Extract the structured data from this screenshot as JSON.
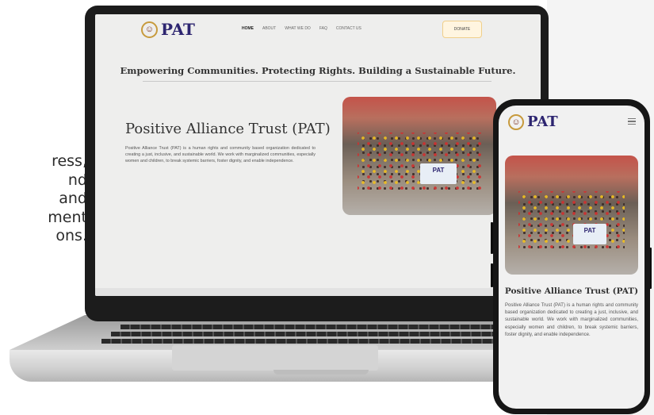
{
  "side_text_lines": [
    "ress,",
    "nd",
    "and",
    "ment",
    "ons."
  ],
  "laptop_site": {
    "logo": "PAT",
    "menu": [
      "HOME",
      "ABOUT",
      "WHAT WE DO",
      "FAQ",
      "CONTACT US"
    ],
    "donate_label": "DONATE",
    "tagline": "Empowering Communities. Protecting Rights. Building a Sustainable Future.",
    "hero_title": "Positive Alliance Trust (PAT)",
    "hero_desc": "Positive Alliance Trust (PAT) is a human rights and community based organization dedicated to creating a just, inclusive, and sustainable world. We work with marginalized communities, especially women and children, to break systemic barriers, foster dignity, and enable independence.",
    "banner_text": "PAT"
  },
  "phone_site": {
    "logo": "PAT",
    "title": "Positive Alliance Trust (PAT)",
    "desc": "Positive Alliance Trust (PAT) is a human rights and community based organization dedicated to creating a just, inclusive, and sustainable world. We work with marginalized communities, especially women and children, to break systemic barriers, foster dignity, and enable independence.",
    "banner_text": "PAT"
  },
  "colors": {
    "brand": "#2d2570",
    "logo_ring": "#c79a3d",
    "donate_bg": "#fff5e0"
  }
}
